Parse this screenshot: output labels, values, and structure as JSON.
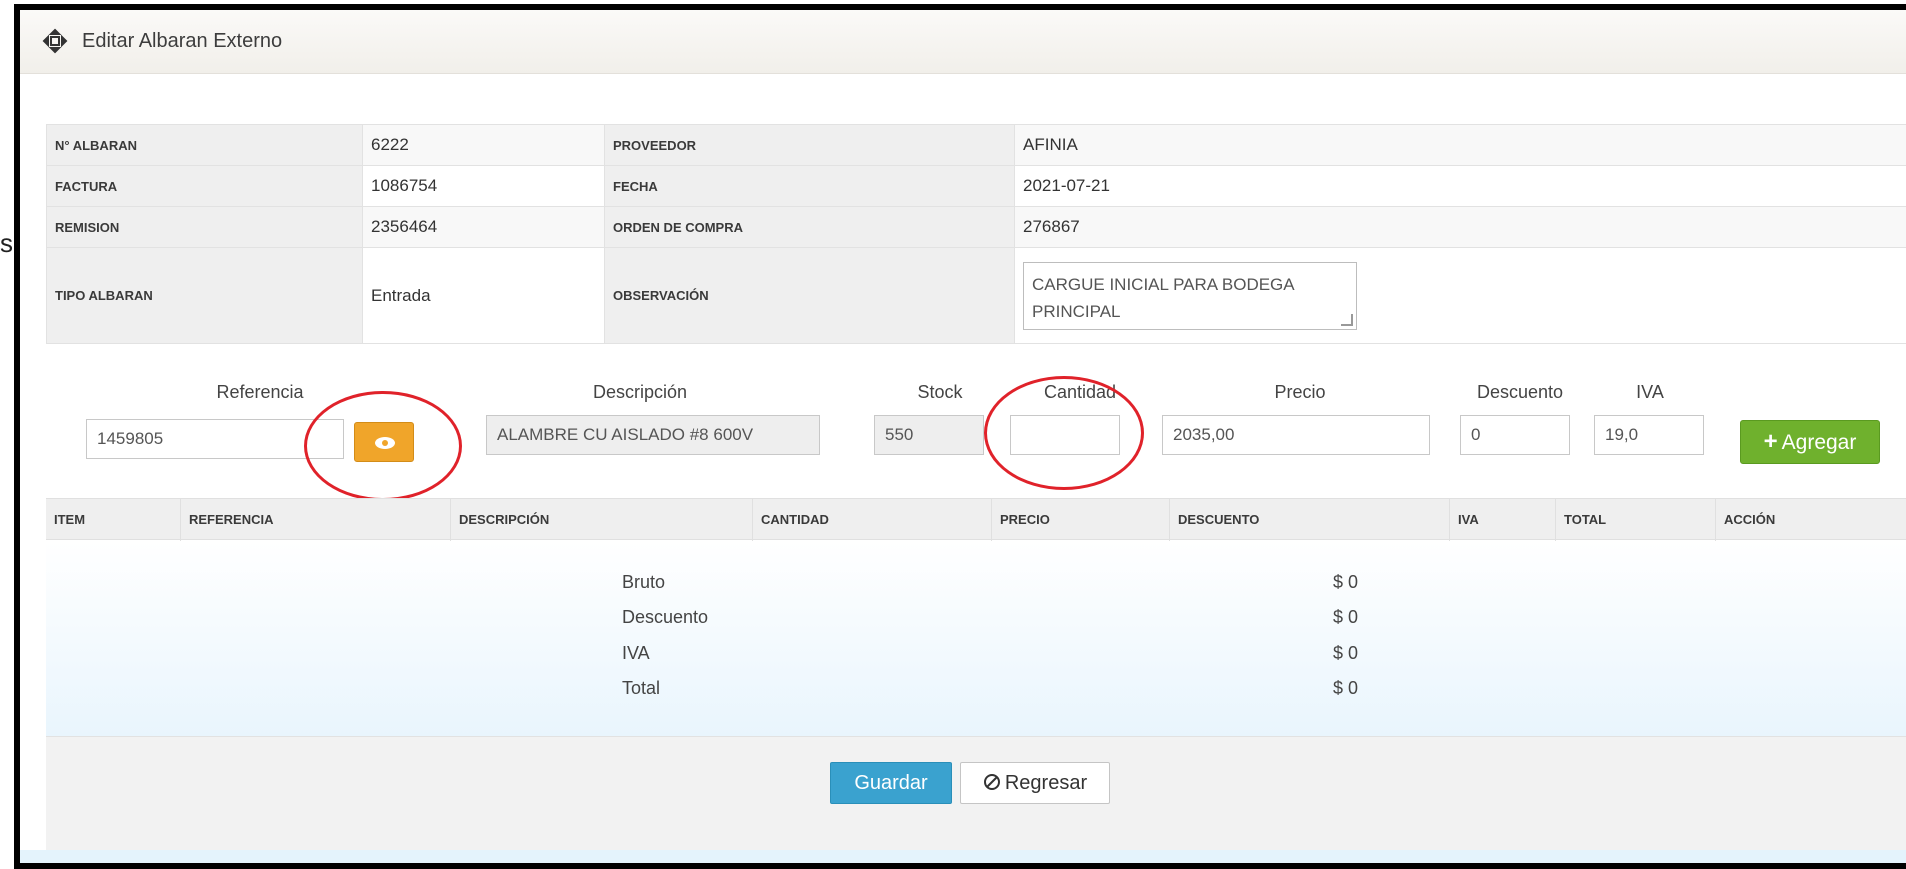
{
  "window": {
    "title": "Editar Albaran Externo",
    "stray_char": "s"
  },
  "info": {
    "rows": [
      {
        "label1": "N° ALBARAN",
        "value1": "6222",
        "label2": "PROVEEDOR",
        "value2": "AFINIA"
      },
      {
        "label1": "FACTURA",
        "value1": "1086754",
        "label2": "FECHA",
        "value2": "2021-07-21"
      },
      {
        "label1": "REMISION",
        "value1": "2356464",
        "label2": "ORDEN DE COMPRA",
        "value2": "276867"
      }
    ],
    "tipo_label": "TIPO ALBARAN",
    "tipo_value": "Entrada",
    "obs_label": "OBSERVACIÓN",
    "obs_value": "CARGUE INICIAL PARA BODEGA PRINCIPAL"
  },
  "form": {
    "referencia_label": "Referencia",
    "referencia_value": "1459805",
    "descripcion_label": "Descripción",
    "descripcion_value": "ALAMBRE CU AISLADO #8 600V",
    "stock_label": "Stock",
    "stock_value": "550",
    "cantidad_label": "Cantidad",
    "cantidad_value": "",
    "precio_label": "Precio",
    "precio_value": "2035,00",
    "descuento_label": "Descuento",
    "descuento_value": "0",
    "iva_label": "IVA",
    "iva_value": "19,0",
    "add_label": "Agregar"
  },
  "grid": {
    "columns": [
      "ITEM",
      "REFERENCIA",
      "DESCRIPCIÓN",
      "CANTIDAD",
      "PRECIO",
      "DESCUENTO",
      "IVA",
      "TOTAL",
      "ACCIÓN"
    ]
  },
  "totals": {
    "bruto_label": "Bruto",
    "bruto_value": "$ 0",
    "descuento_label": "Descuento",
    "descuento_value": "$ 0",
    "iva_label": "IVA",
    "iva_value": "$ 0",
    "total_label": "Total",
    "total_value": "$ 0"
  },
  "actions": {
    "save_label": "Guardar",
    "back_label": "Regresar"
  },
  "colors": {
    "accent_orange": "#f0a52a",
    "accent_green": "#6fb12d",
    "accent_blue": "#3aa2cf",
    "annotation_red": "#e0222a"
  },
  "icons": {
    "header": "move-icon",
    "view": "eye-icon",
    "add": "plus-icon",
    "back": "ban-icon"
  }
}
